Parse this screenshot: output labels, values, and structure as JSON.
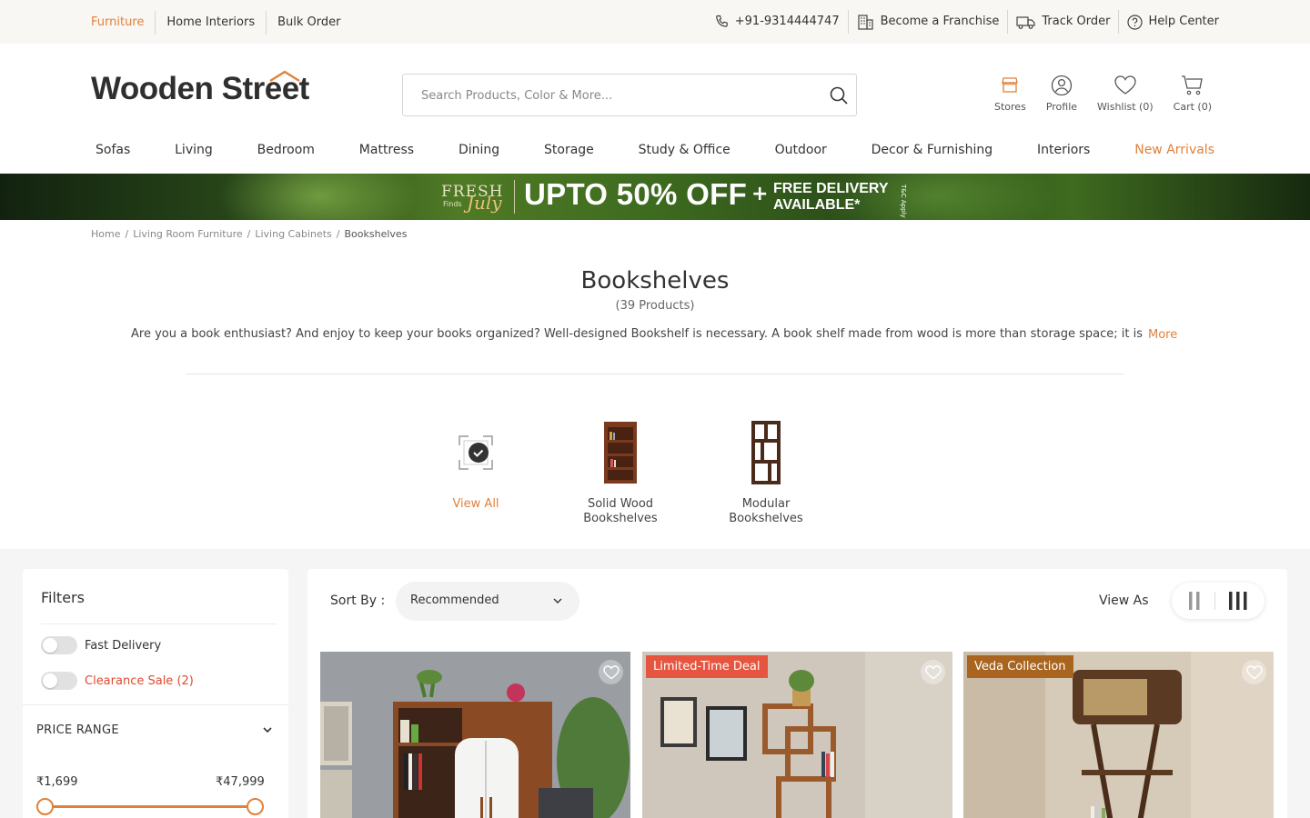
{
  "topbar": {
    "links": [
      "Furniture",
      "Home Interiors",
      "Bulk Order"
    ],
    "phone": "+91-9314444747",
    "franchise": "Become a Franchise",
    "track": "Track Order",
    "help": "Help Center"
  },
  "header": {
    "logo": "Wooden Street",
    "search_placeholder": "Search Products, Color & More...",
    "icons": [
      {
        "label": "Stores",
        "icon": "store-icon"
      },
      {
        "label": "Profile",
        "icon": "profile-icon"
      },
      {
        "label": "Wishlist (0)",
        "icon": "heart-icon"
      },
      {
        "label": "Cart (0)",
        "icon": "cart-icon"
      }
    ]
  },
  "nav": [
    "Sofas",
    "Living",
    "Bedroom",
    "Mattress",
    "Dining",
    "Storage",
    "Study & Office",
    "Outdoor",
    "Decor & Furnishing",
    "Interiors",
    "New Arrivals"
  ],
  "banner": {
    "fresh": "FRESH",
    "finds": "Finds",
    "july": "July",
    "offer": "UPTO 50% OFF",
    "plus": "+",
    "free_line1": "FREE DELIVERY",
    "free_line2": "AVAILABLE*",
    "tc": "T&C Apply"
  },
  "breadcrumb": [
    "Home",
    "Living Room Furniture",
    "Living Cabinets",
    "Bookshelves"
  ],
  "page": {
    "title": "Bookshelves",
    "count": "(39 Products)",
    "description": "Are you a book enthusiast? And enjoy to keep your books organized? Well-designed Bookshelf is necessary. A book shelf made from wood is more than storage space; it is",
    "more": "More"
  },
  "categories": [
    {
      "label": "View  All",
      "active": true
    },
    {
      "label": "Solid Wood Bookshelves"
    },
    {
      "label": "Modular Bookshelves"
    }
  ],
  "filters": {
    "title": "Filters",
    "fast_delivery": "Fast Delivery",
    "clearance": "Clearance Sale (2)",
    "price_range": "PRICE RANGE",
    "min": "₹1,699",
    "max": "₹47,999"
  },
  "sort": {
    "label": "Sort By :",
    "value": "Recommended",
    "view_as": "View As"
  },
  "products": [
    {
      "tag": ""
    },
    {
      "tag": "Limited-Time Deal",
      "tag_color": "#e5553f"
    },
    {
      "tag": "Veda Collection",
      "tag_color": "#a9651f"
    }
  ],
  "colors": {
    "accent": "#e0813b",
    "red": "#e04a2f"
  }
}
